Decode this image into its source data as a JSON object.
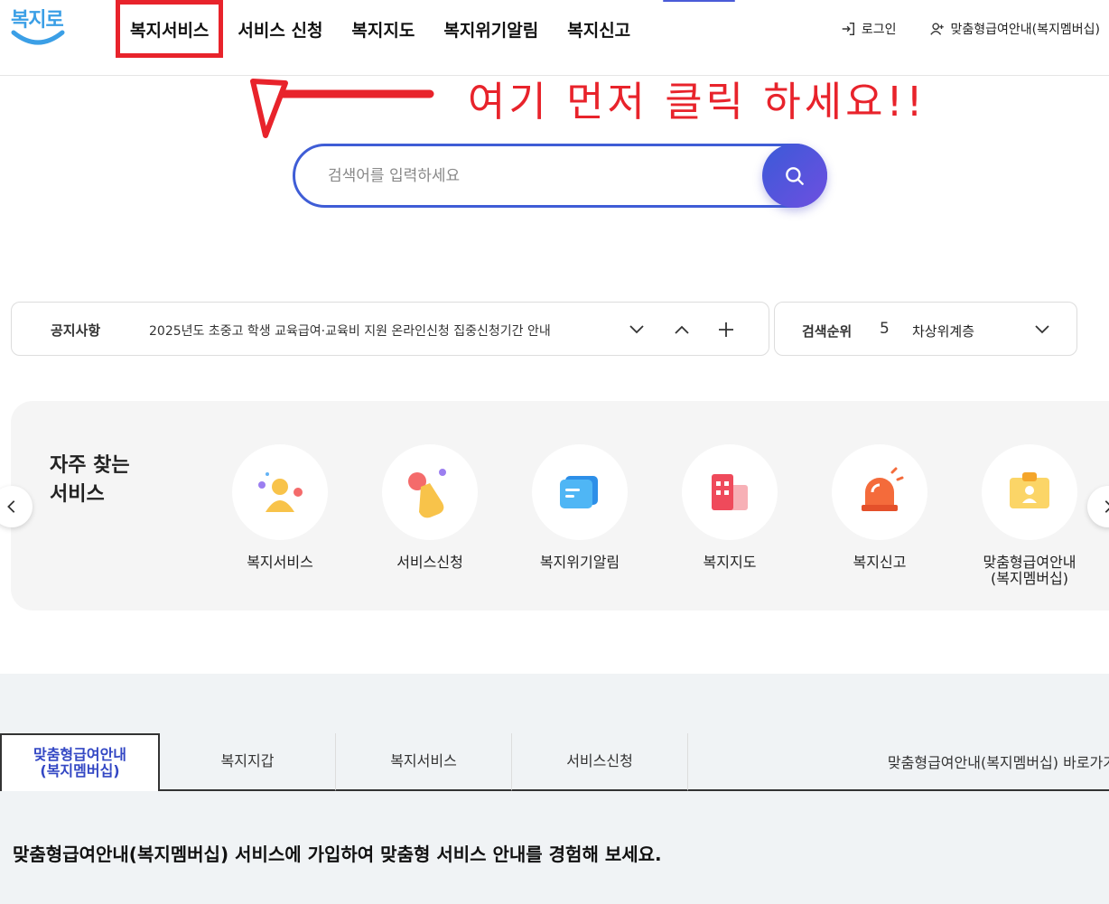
{
  "header": {
    "logo_text": "복지로",
    "nav": [
      "복지서비스",
      "서비스 신청",
      "복지지도",
      "복지위기알림",
      "복지신고"
    ],
    "login": "로그인",
    "membership": "맞춤형급여안내(복지멤버십)"
  },
  "annotation": {
    "text": "여기 먼저 클릭 하세요!!",
    "color": "#e8232b"
  },
  "search": {
    "placeholder": "검색어를 입력하세요"
  },
  "notice": {
    "label": "공지사항",
    "text": "2025년도 초중고 학생 교육급여·교육비 지원 온라인신청 집중신청기간 안내"
  },
  "ranking": {
    "label": "검색순위",
    "rank": "5",
    "term": "차상위계층"
  },
  "frequent": {
    "title_line1": "자주 찾는",
    "title_line2": "서비스",
    "items": [
      {
        "label": "복지서비스",
        "icon": "people-icon"
      },
      {
        "label": "서비스신청",
        "icon": "hand-pointer-icon"
      },
      {
        "label": "복지위기알림",
        "icon": "message-icon"
      },
      {
        "label": "복지지도",
        "icon": "building-icon"
      },
      {
        "label": "복지신고",
        "icon": "siren-icon"
      },
      {
        "label_line1": "맞춤형급여안내",
        "label_line2": "(복지멤버십)",
        "icon": "id-card-icon"
      }
    ]
  },
  "bottom": {
    "tabs": [
      {
        "line1": "맞춤형급여안내",
        "line2": "(복지멤버십)"
      },
      {
        "label": "복지지갑"
      },
      {
        "label": "복지서비스"
      },
      {
        "label": "서비스신청"
      }
    ],
    "shortcut": "맞춤형급여안내(복지멤버십) 바로가기",
    "description": "맞춤형급여안내(복지멤버십) 서비스에 가입하여 맞춤형 서비스 안내를 경험해 보세요."
  },
  "colors": {
    "accent": "#3f5dd6",
    "active_tab": "#3347c4"
  }
}
